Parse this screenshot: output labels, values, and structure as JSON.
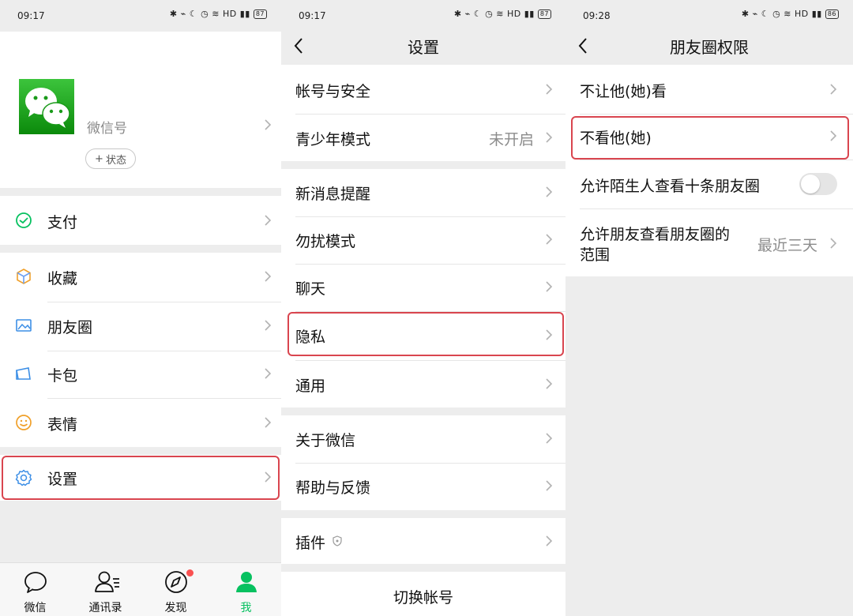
{
  "panel_me": {
    "status": {
      "time": "09:17",
      "network": "HD",
      "battery": "87"
    },
    "profile": {
      "wechat_id_label": "微信号",
      "status_button": "状态"
    },
    "menu": {
      "pay": "支付",
      "favorites": "收藏",
      "moments": "朋友圈",
      "cards": "卡包",
      "stickers": "表情",
      "settings": "设置"
    },
    "tabs": {
      "chats": "微信",
      "contacts": "通讯录",
      "discover": "发现",
      "me": "我"
    }
  },
  "panel_settings": {
    "status": {
      "time": "09:17",
      "network": "HD",
      "battery": "87"
    },
    "title": "设置",
    "items": {
      "account_security": "帐号与安全",
      "youth_mode": "青少年模式",
      "youth_mode_value": "未开启",
      "notifications": "新消息提醒",
      "do_not_disturb": "勿扰模式",
      "chat": "聊天",
      "privacy": "隐私",
      "general": "通用",
      "about": "关于微信",
      "help": "帮助与反馈",
      "plugins": "插件",
      "switch_account": "切换帐号"
    }
  },
  "panel_moments_permissions": {
    "status": {
      "time": "09:28",
      "network": "HD",
      "battery": "86"
    },
    "title": "朋友圈权限",
    "items": {
      "hide_my_posts": "不让他(她)看",
      "hide_their_posts": "不看他(她)",
      "allow_strangers_label": "允许陌生人查看十条朋友圈",
      "allow_strangers_on": false,
      "visible_range_line1": "允许朋友查看朋友圈的",
      "visible_range_line2": "范围",
      "visible_range_value": "最近三天"
    }
  },
  "colors": {
    "accent_green": "#07c160",
    "highlight_red": "#d9454f",
    "background": "#ededed",
    "secondary_text": "#8c8c8c"
  }
}
